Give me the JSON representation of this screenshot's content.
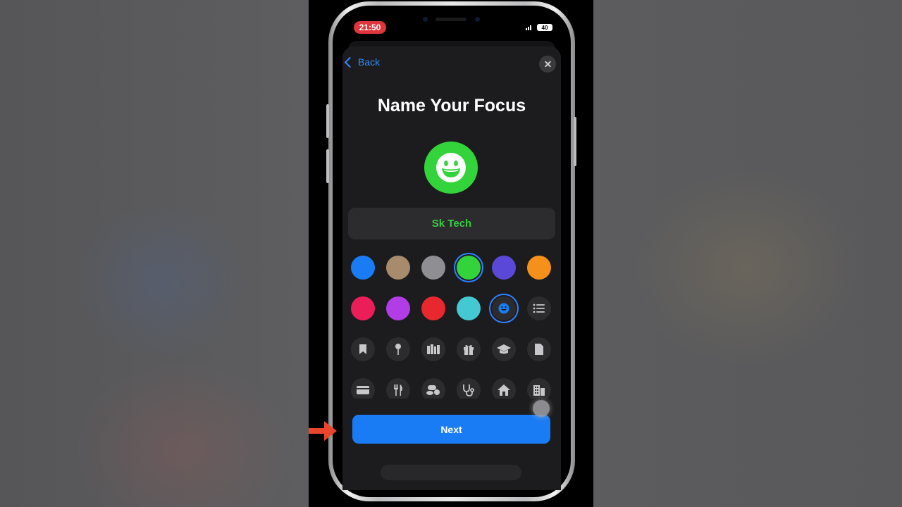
{
  "status_bar": {
    "time": "21:50",
    "battery": "40"
  },
  "nav": {
    "back_label": "Back",
    "close_icon": "xmark-icon"
  },
  "page": {
    "title": "Name Your Focus"
  },
  "focus": {
    "name": "Sk Tech",
    "icon": "smiley-face-icon",
    "color": "#33d33b"
  },
  "colors": [
    "#1a7cf5",
    "#a88a6c",
    "#8e8e93",
    "#33d33b",
    "#5a48d8",
    "#f5901a",
    "#ec1e5a",
    "#b23de6",
    "#e8282e",
    "#44c8d2"
  ],
  "selected_color_index": 3,
  "selected_glyph": "smiley-face-icon",
  "glyphs_row_2": [
    "smiley-face-icon",
    "list-icon"
  ],
  "glyphs_row_3": [
    "bookmark-icon",
    "pin-icon",
    "books-icon",
    "gift-icon",
    "graduation-cap-icon",
    "document-icon"
  ],
  "glyphs_row_4": [
    "credit-card-icon",
    "fork-knife-icon",
    "pills-icon",
    "stethoscope-icon",
    "house-icon",
    "building-icon"
  ],
  "primary_button": {
    "label": "Next"
  },
  "accent": "#1a7cf5",
  "annotation_arrow_color": "#e8452c"
}
